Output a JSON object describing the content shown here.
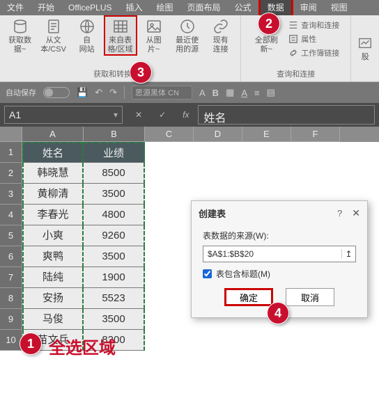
{
  "menu": {
    "items": [
      "文件",
      "开始",
      "OfficePLUS",
      "插入",
      "绘图",
      "页面布局",
      "公式",
      "数据",
      "审阅",
      "视图"
    ],
    "active_index": 7
  },
  "ribbon": {
    "group1": {
      "label": "获取和转换数据",
      "buttons": [
        {
          "label": "获取数\n据~"
        },
        {
          "label": "从文\n本/CSV"
        },
        {
          "label": "自\n网站"
        },
        {
          "label": "来自表\n格/区域"
        },
        {
          "label": "从图\n片~"
        },
        {
          "label": "最近使\n用的源"
        },
        {
          "label": "现有\n连接"
        }
      ]
    },
    "group2": {
      "label": "查询和连接",
      "main_label": "全部刷\n新~",
      "rows": [
        "查询和连接",
        "属性",
        "工作簿链接"
      ]
    },
    "stock_label": "股"
  },
  "qat": {
    "autosave": "自动保存",
    "font": "思源黑体 CN"
  },
  "namebar": {
    "cell": "A1",
    "formula": "姓名"
  },
  "columns": [
    "A",
    "B",
    "C",
    "D",
    "E",
    "F"
  ],
  "table": {
    "headers": [
      "姓名",
      "业绩"
    ],
    "rows": [
      [
        "韩晓慧",
        "8500"
      ],
      [
        "黄柳清",
        "3500"
      ],
      [
        "李春光",
        "4800"
      ],
      [
        "小爽",
        "9260"
      ],
      [
        "爽鸭",
        "3500"
      ],
      [
        "陆纯",
        "1900"
      ],
      [
        "安扬",
        "5523"
      ],
      [
        "马俊",
        "3500"
      ],
      [
        "苗文兵",
        "8200"
      ]
    ]
  },
  "dialog": {
    "title": "创建表",
    "source_label": "表数据的来源(W):",
    "source_value": "$A$1:$B$20",
    "checkbox_label": "表包含标题(M)",
    "ok": "确定",
    "cancel": "取消"
  },
  "annotation_text": "全选区域",
  "markers": {
    "m1": "1",
    "m2": "2",
    "m3": "3",
    "m4": "4"
  }
}
